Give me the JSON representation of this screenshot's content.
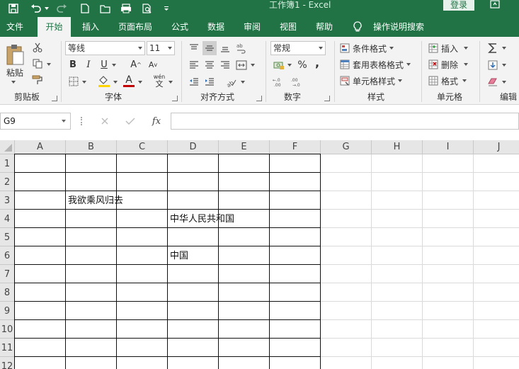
{
  "app": {
    "title": "工作簿1  -  Excel",
    "login_label": "登录"
  },
  "tabs": [
    {
      "label": "文件",
      "active": false
    },
    {
      "label": "开始",
      "active": true
    },
    {
      "label": "插入",
      "active": false
    },
    {
      "label": "页面布局",
      "active": false
    },
    {
      "label": "公式",
      "active": false
    },
    {
      "label": "数据",
      "active": false
    },
    {
      "label": "审阅",
      "active": false
    },
    {
      "label": "视图",
      "active": false
    },
    {
      "label": "帮助",
      "active": false
    }
  ],
  "tell_me": "操作说明搜索",
  "ribbon": {
    "clipboard": {
      "paste_label": "粘贴",
      "group_label": "剪贴板"
    },
    "font": {
      "font_name": "等线",
      "font_size": "11",
      "bold": "B",
      "italic": "I",
      "underline": "U",
      "grow": "A",
      "shrink": "A",
      "wen": "wén",
      "wen_char": "文",
      "font_color_letter": "A",
      "group_label": "字体"
    },
    "alignment": {
      "group_label": "对齐方式"
    },
    "number": {
      "format": "常规",
      "percent": "%",
      "comma": ",",
      "group_label": "数字"
    },
    "styles": {
      "conditional": "条件格式",
      "table": "套用表格格式",
      "cell_styles": "单元格样式",
      "group_label": "样式"
    },
    "cells": {
      "insert": "插入",
      "delete": "删除",
      "format": "格式",
      "group_label": "单元格"
    },
    "editing": {
      "group_label": "编辑"
    }
  },
  "formula_bar": {
    "name_box": "G9",
    "fx": "fx",
    "formula": ""
  },
  "sheet": {
    "columns": [
      "A",
      "B",
      "C",
      "D",
      "E",
      "F",
      "G",
      "H",
      "I",
      "J"
    ],
    "rows": [
      "1",
      "2",
      "3",
      "4",
      "5",
      "6",
      "7",
      "8",
      "9",
      "10",
      "11",
      "12"
    ],
    "cells": [
      {
        "ref": "B3",
        "col": 1,
        "row": 2,
        "value": "我欲乘风归去"
      },
      {
        "ref": "D4",
        "col": 3,
        "row": 3,
        "value": "中华人民共和国"
      },
      {
        "ref": "D6",
        "col": 3,
        "row": 5,
        "value": "中国"
      }
    ],
    "bordered_range": {
      "first_col": 0,
      "last_col": 5,
      "first_row": 0,
      "last_row": 11
    }
  },
  "colors": {
    "excel_green": "#217346",
    "ribbon_bg": "#f3f3f3",
    "header_bg": "#e6e6e6"
  }
}
